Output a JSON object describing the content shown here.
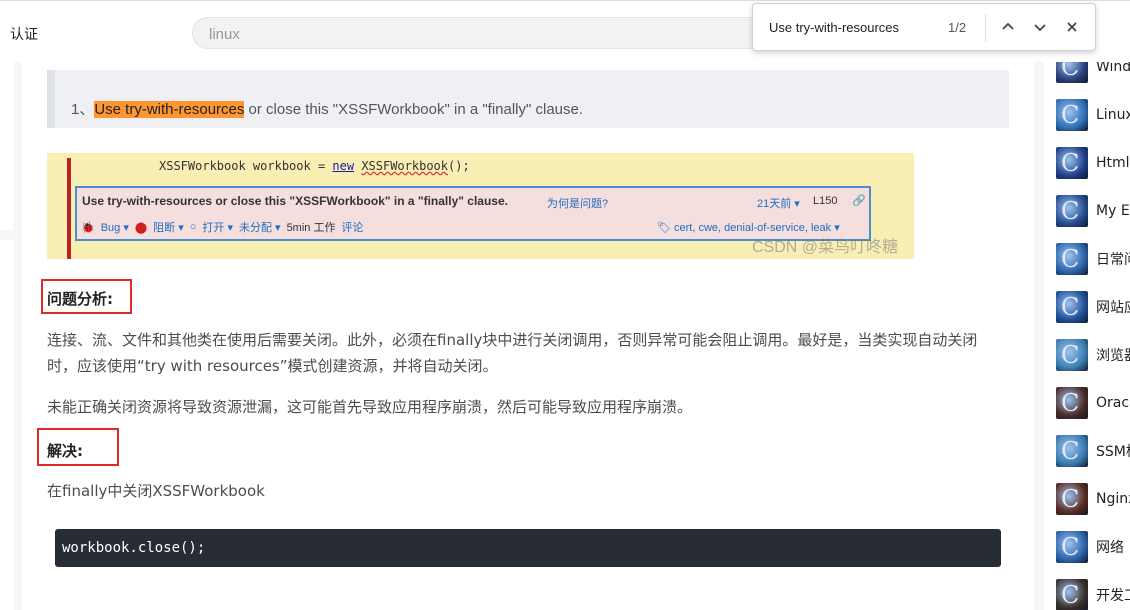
{
  "header": {
    "auth_label": "认证",
    "search_value": "linux"
  },
  "find_bar": {
    "query": "Use try-with-resources",
    "count": "1/2",
    "prev_icon": "chevron-up-icon",
    "next_icon": "chevron-down-icon",
    "close_icon": "close-icon"
  },
  "article": {
    "quote_prefix": "1、",
    "quote_highlight": "Use try-with-resources",
    "quote_rest": " or close this \"XSSFWorkbook\" in a \"finally\" clause.",
    "screenshot": {
      "code_line": "XSSFWorkbook workbook = ",
      "code_new": "new",
      "code_ctor": "XSSFWorkbook",
      "code_end": "();",
      "issue_message": "Use try-with-resources or close this \"XSSFWorkbook\" in a \"finally\" clause.",
      "why_link": "为何是问题?",
      "age": "21天前 ▾",
      "line": "L150",
      "type": "Bug ▾",
      "severity": "阻断 ▾",
      "status": "打开 ▾",
      "assignee": "未分配 ▾",
      "effort": "5min 工作",
      "comment": "评论",
      "tags": "cert, cwe, denial-of-service, leak ▾",
      "watermark": "CSDN @菜鸟叮咚糖"
    },
    "analysis_heading": "问题分析:",
    "analysis_p1": "连接、流、文件和其他类在使用后需要关闭。此外，必须在finally块中进行关闭调用，否则异常可能会阻止调用。最好是，当类实现自动关闭时，应该使用“try with resources”模式创建资源，并将自动关闭。",
    "analysis_p2": "未能正确关闭资源将导致资源泄漏，这可能首先导致应用程序崩溃，然后可能导致应用程序崩溃。",
    "solution_heading": "解决:",
    "solution_text": "在finally中关闭XSSFWorkbook",
    "code": "workbook.close();"
  },
  "sidebar": {
    "items": [
      {
        "label": "Windo",
        "color": "#2a3f7a"
      },
      {
        "label": "Linux",
        "color": "#2f6fb5"
      },
      {
        "label": "HtmlH",
        "color": "#1d3f8a"
      },
      {
        "label": "My Ec",
        "color": "#244b8f"
      },
      {
        "label": "日常问",
        "color": "#2b63a8"
      },
      {
        "label": "网站应",
        "color": "#1e4e97"
      },
      {
        "label": "浏览器",
        "color": "#3c7fb2"
      },
      {
        "label": "Oracl",
        "color": "#4a2a25"
      },
      {
        "label": "SSM框",
        "color": "#3a7ab0"
      },
      {
        "label": "Nginx",
        "color": "#5a2a1e"
      },
      {
        "label": "网络",
        "color": "#2c62a8"
      },
      {
        "label": "开发工",
        "color": "#3a2e2a"
      }
    ]
  }
}
